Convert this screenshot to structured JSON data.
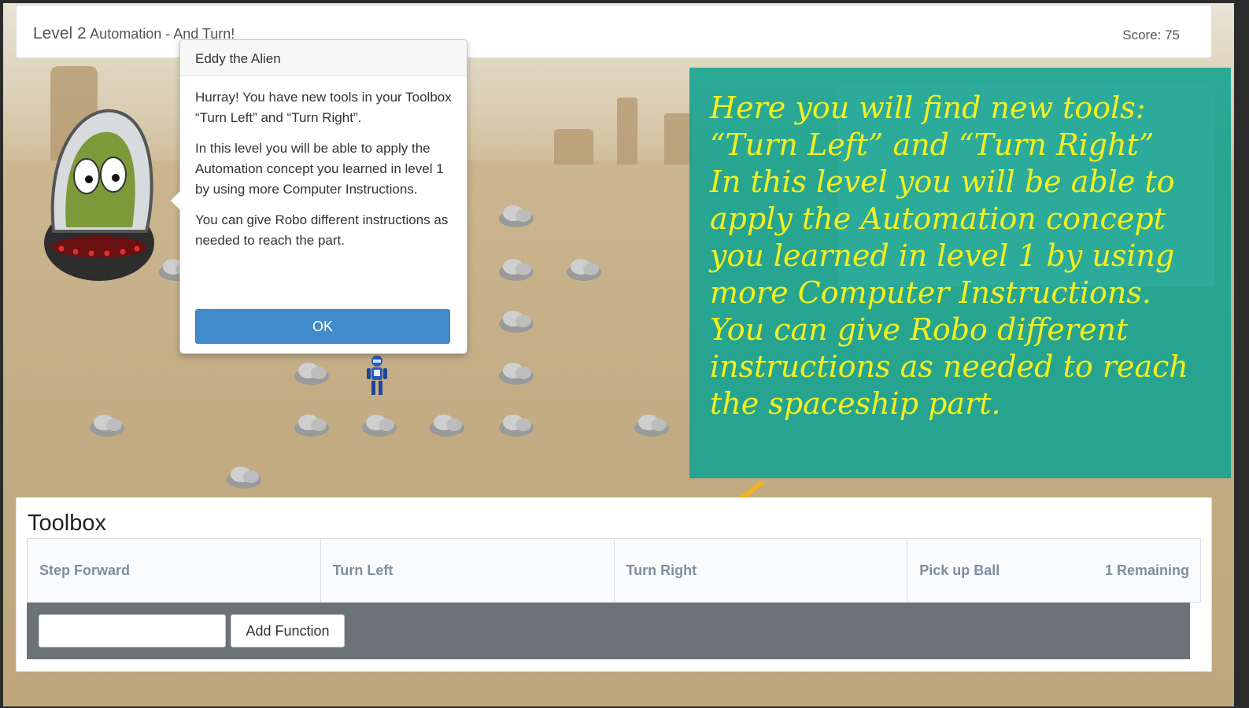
{
  "header": {
    "level": "Level 2",
    "subtitle": "Automation - And Turn!",
    "score": "Score: 75"
  },
  "dialog": {
    "title": "Eddy the Alien",
    "paragraphs": [
      "Hurray! You have new tools in your Toolbox “Turn Left” and “Turn Right”.",
      "In this level you will be able to apply the Automation concept you learned in level 1 by using more Computer Instructions.",
      "You can give Robo different instructions as needed to reach the part."
    ],
    "ok_label": "OK"
  },
  "annotation": {
    "text": "Here you will find new tools:\n“Turn Left”  and “Turn Right”\nIn this level you will be able to\napply the Automation concept\nyou learned in level 1 by using\nmore Computer Instructions.\n You can give Robo different\ninstructions as needed to reach\nthe spaceship part.",
    "text_color": "#f3f01e",
    "bg_color": "#11a391"
  },
  "toolbox": {
    "title": "Toolbox",
    "tools": [
      {
        "label": "Step Forward",
        "remaining": ""
      },
      {
        "label": "Turn Left",
        "remaining": ""
      },
      {
        "label": "Turn Right",
        "remaining": ""
      },
      {
        "label": "Pick up Ball",
        "remaining": "1 Remaining"
      }
    ],
    "function_input_value": "",
    "add_function_label": "Add Function"
  },
  "colors": {
    "ok_button": "#428bca",
    "function_bar": "#6b7377",
    "tool_label": "#7d8fa0"
  }
}
